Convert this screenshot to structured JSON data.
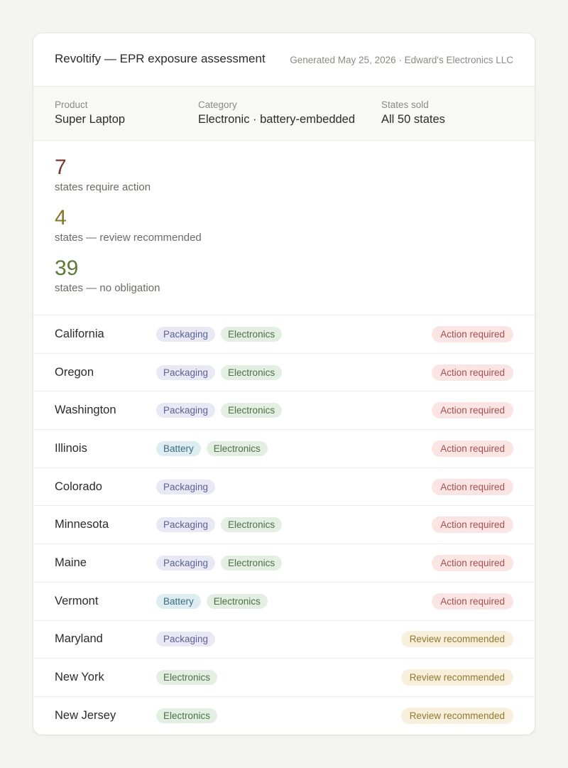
{
  "header": {
    "title": "Revoltify — EPR exposure assessment",
    "meta": "Generated May 25, 2026 · Edward's Electronics LLC"
  },
  "product": {
    "product_label": "Product",
    "product_value": "Super Laptop",
    "category_label": "Category",
    "category_value": "Electronic · battery-embedded",
    "states_label": "States sold",
    "states_value": "All 50 states"
  },
  "summary": {
    "action_count": "7",
    "action_text": "states require action",
    "review_count": "4",
    "review_text": "states — review recommended",
    "none_count": "39",
    "none_text": "states — no obligation"
  },
  "colors": {
    "action": "#7a3a2f",
    "review": "#857525",
    "none": "#5d7a34"
  },
  "states": [
    {
      "name": "California",
      "tags": [
        "Packaging",
        "Electronics"
      ],
      "status": "Action required",
      "level": "action"
    },
    {
      "name": "Oregon",
      "tags": [
        "Packaging",
        "Electronics"
      ],
      "status": "Action required",
      "level": "action"
    },
    {
      "name": "Washington",
      "tags": [
        "Packaging",
        "Electronics"
      ],
      "status": "Action required",
      "level": "action"
    },
    {
      "name": "Illinois",
      "tags": [
        "Battery",
        "Electronics"
      ],
      "status": "Action required",
      "level": "action"
    },
    {
      "name": "Colorado",
      "tags": [
        "Packaging"
      ],
      "status": "Action required",
      "level": "action"
    },
    {
      "name": "Minnesota",
      "tags": [
        "Packaging",
        "Electronics"
      ],
      "status": "Action required",
      "level": "action"
    },
    {
      "name": "Maine",
      "tags": [
        "Packaging",
        "Electronics"
      ],
      "status": "Action required",
      "level": "action"
    },
    {
      "name": "Vermont",
      "tags": [
        "Battery",
        "Electronics"
      ],
      "status": "Action required",
      "level": "action"
    },
    {
      "name": "Maryland",
      "tags": [
        "Packaging"
      ],
      "status": "Review recommended",
      "level": "review"
    },
    {
      "name": "New York",
      "tags": [
        "Electronics"
      ],
      "status": "Review recommended",
      "level": "review"
    },
    {
      "name": "New Jersey",
      "tags": [
        "Electronics"
      ],
      "status": "Review recommended",
      "level": "review"
    }
  ]
}
